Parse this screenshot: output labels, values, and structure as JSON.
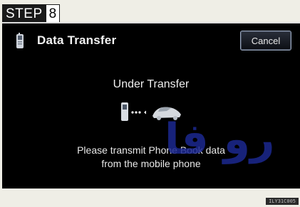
{
  "step": {
    "label": "STEP",
    "number": "8"
  },
  "header": {
    "title": "Data Transfer",
    "cancel_label": "Cancel",
    "phone_icon": "mobile-phone-icon"
  },
  "main": {
    "status": "Under Transfer",
    "transfer_icon": "phone-to-car-transfer-icon",
    "message_line1": "Please transmit Phone Book data",
    "message_line2": "from the mobile phone"
  },
  "watermark": "رو فا",
  "footer": {
    "code": "ILY31C005"
  },
  "colors": {
    "screen_bg": "#000000",
    "page_bg": "#efeee6",
    "watermark": "#1c2890"
  }
}
